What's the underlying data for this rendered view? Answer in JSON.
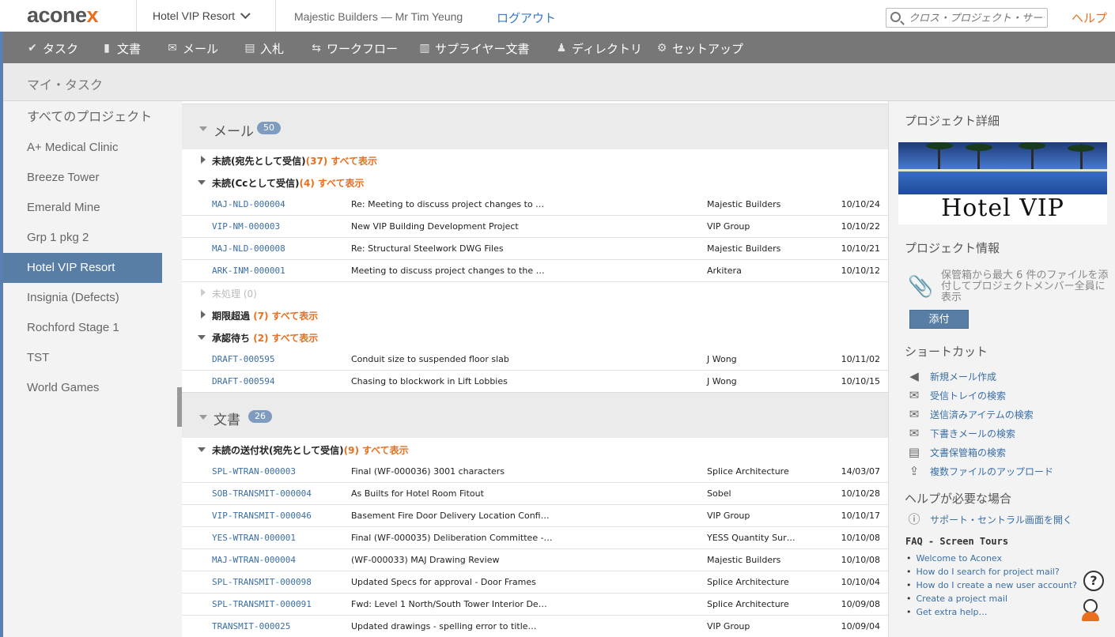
{
  "app": {
    "logo_main": "acone",
    "logo_x": "x"
  },
  "header": {
    "project_selector": "Hotel VIP Resort",
    "user": "Majestic Builders  —  Mr Tim Yeung",
    "logout": "ログアウト",
    "search_placeholder": "クロス・プロジェクト・サーチ",
    "help": "ヘルプ"
  },
  "nav": [
    {
      "label": "タスク",
      "icon": "check-icon"
    },
    {
      "label": "文書",
      "icon": "document-icon"
    },
    {
      "label": "メール",
      "icon": "mail-icon"
    },
    {
      "label": "入札",
      "icon": "tender-icon"
    },
    {
      "label": "ワークフロー",
      "icon": "workflow-icon"
    },
    {
      "label": "サプライヤー文書",
      "icon": "supplier-docs-icon"
    },
    {
      "label": "ディレクトリ",
      "icon": "people-icon"
    },
    {
      "label": "セットアップ",
      "icon": "gear-icon"
    }
  ],
  "page_title": "マイ・タスク",
  "sidebar": {
    "items": [
      "すべてのプロジェクト",
      "A+ Medical Clinic",
      "Breeze Tower",
      "Emerald Mine",
      "Grp 1 pkg 2",
      "Hotel VIP Resort",
      "Insignia (Defects)",
      "Rochford Stage 1",
      "TST",
      "World Games"
    ],
    "active": "Hotel VIP Resort"
  },
  "mail_section": {
    "title": "メール",
    "count": "50",
    "groups": {
      "unread_to": {
        "label": "未読(宛先として受信)",
        "count": "(37)",
        "show_all": "すべて表示"
      },
      "unread_cc": {
        "label": "未読(Ccとして受信)",
        "count": "(4)",
        "show_all": "すべて表示"
      },
      "unprocessed": {
        "label": "未処理 (0)"
      },
      "overdue": {
        "label": "期限超過",
        "count": "(7)",
        "show_all": "すべて表示"
      },
      "pending": {
        "label": "承認待ち",
        "count": "(2)",
        "show_all": "すべて表示"
      }
    },
    "cc_rows": [
      {
        "id": "MAJ-NLD-000004",
        "subject": "Re: Meeting to discuss project changes to …",
        "from": "Majestic Builders",
        "date": "10/10/24"
      },
      {
        "id": "VIP-NM-000003",
        "subject": "New VIP Building Development Project",
        "from": "VIP Group",
        "date": "10/10/22"
      },
      {
        "id": "MAJ-NLD-000008",
        "subject": "Re: Structural Steelwork DWG Files",
        "from": "Majestic Builders",
        "date": "10/10/21"
      },
      {
        "id": "ARK-INM-000001",
        "subject": "Meeting to discuss project changes to the …",
        "from": "Arkitera",
        "date": "10/10/12"
      }
    ],
    "pending_rows": [
      {
        "id": "DRAFT-000595",
        "subject": "Conduit size to suspended floor slab",
        "from": "J Wong",
        "date": "10/11/02"
      },
      {
        "id": "DRAFT-000594",
        "subject": "Chasing to blockwork in Lift Lobbies",
        "from": "J Wong",
        "date": "10/10/15"
      }
    ]
  },
  "doc_section": {
    "title": "文書",
    "count": "26",
    "group": {
      "label": "未読の送付状(宛先として受信)",
      "count": "(9)",
      "show_all": "すべて表示"
    },
    "rows": [
      {
        "id": "SPL-WTRAN-000003",
        "subject": "Final (WF-000036) 3001 characters",
        "from": "Splice Architecture",
        "date": "14/03/07"
      },
      {
        "id": "SOB-TRANSMIT-000004",
        "subject": "As Builts for Hotel Room Fitout",
        "from": "Sobel",
        "date": "10/10/28"
      },
      {
        "id": "VIP-TRANSMIT-000046",
        "subject": "Basement Fire Door Delivery Location Confi…",
        "from": "VIP Group",
        "date": "10/10/17"
      },
      {
        "id": "YES-WTRAN-000001",
        "subject": "Final (WF-000035) Deliberation Committee -…",
        "from": "YESS Quantity Sur…",
        "date": "10/10/08"
      },
      {
        "id": "MAJ-WTRAN-000004",
        "subject": "(WF-000033) MAJ Drawing Review",
        "from": "Majestic Builders",
        "date": "10/10/08"
      },
      {
        "id": "SPL-TRANSMIT-000098",
        "subject": "Updated Specs for approval - Door Frames",
        "from": "Splice Architecture",
        "date": "10/10/04"
      },
      {
        "id": "SPL-TRANSMIT-000091",
        "subject": "Fwd: Level 1 North/South Tower Interior De…",
        "from": "Splice Architecture",
        "date": "10/09/08"
      },
      {
        "id": "TRANSMIT-000025",
        "subject": "Updated drawings - spelling error to title…",
        "from": "VIP Group",
        "date": "10/09/04"
      }
    ]
  },
  "right": {
    "project_details": "プロジェクト詳細",
    "hero_text": "Hotel VIP",
    "project_info": "プロジェクト情報",
    "attach_text": "保管箱から最大 6 件のファイルを添付してプロジェクトメンバー全員に表示",
    "attach_button": "添付",
    "shortcuts_title": "ショートカット",
    "shortcuts": [
      {
        "label": "新規メール作成",
        "icon": "send-icon"
      },
      {
        "label": "受信トレイの検索",
        "icon": "inbox-icon"
      },
      {
        "label": "送信済みアイテムの検索",
        "icon": "sent-icon"
      },
      {
        "label": "下書きメールの検索",
        "icon": "draft-icon"
      },
      {
        "label": "文書保管箱の検索",
        "icon": "doc-register-icon"
      },
      {
        "label": "複数ファイルのアップロード",
        "icon": "upload-icon"
      }
    ],
    "help_title": "ヘルプが必要な場合",
    "support_link": "サポート・セントラル画面を開く",
    "faq_title": "FAQ - Screen Tours",
    "faq": [
      "Welcome to Aconex",
      "How do I search for project mail?",
      "How do I create a new user account?",
      "Create a project mail",
      "Get extra help…"
    ]
  }
}
